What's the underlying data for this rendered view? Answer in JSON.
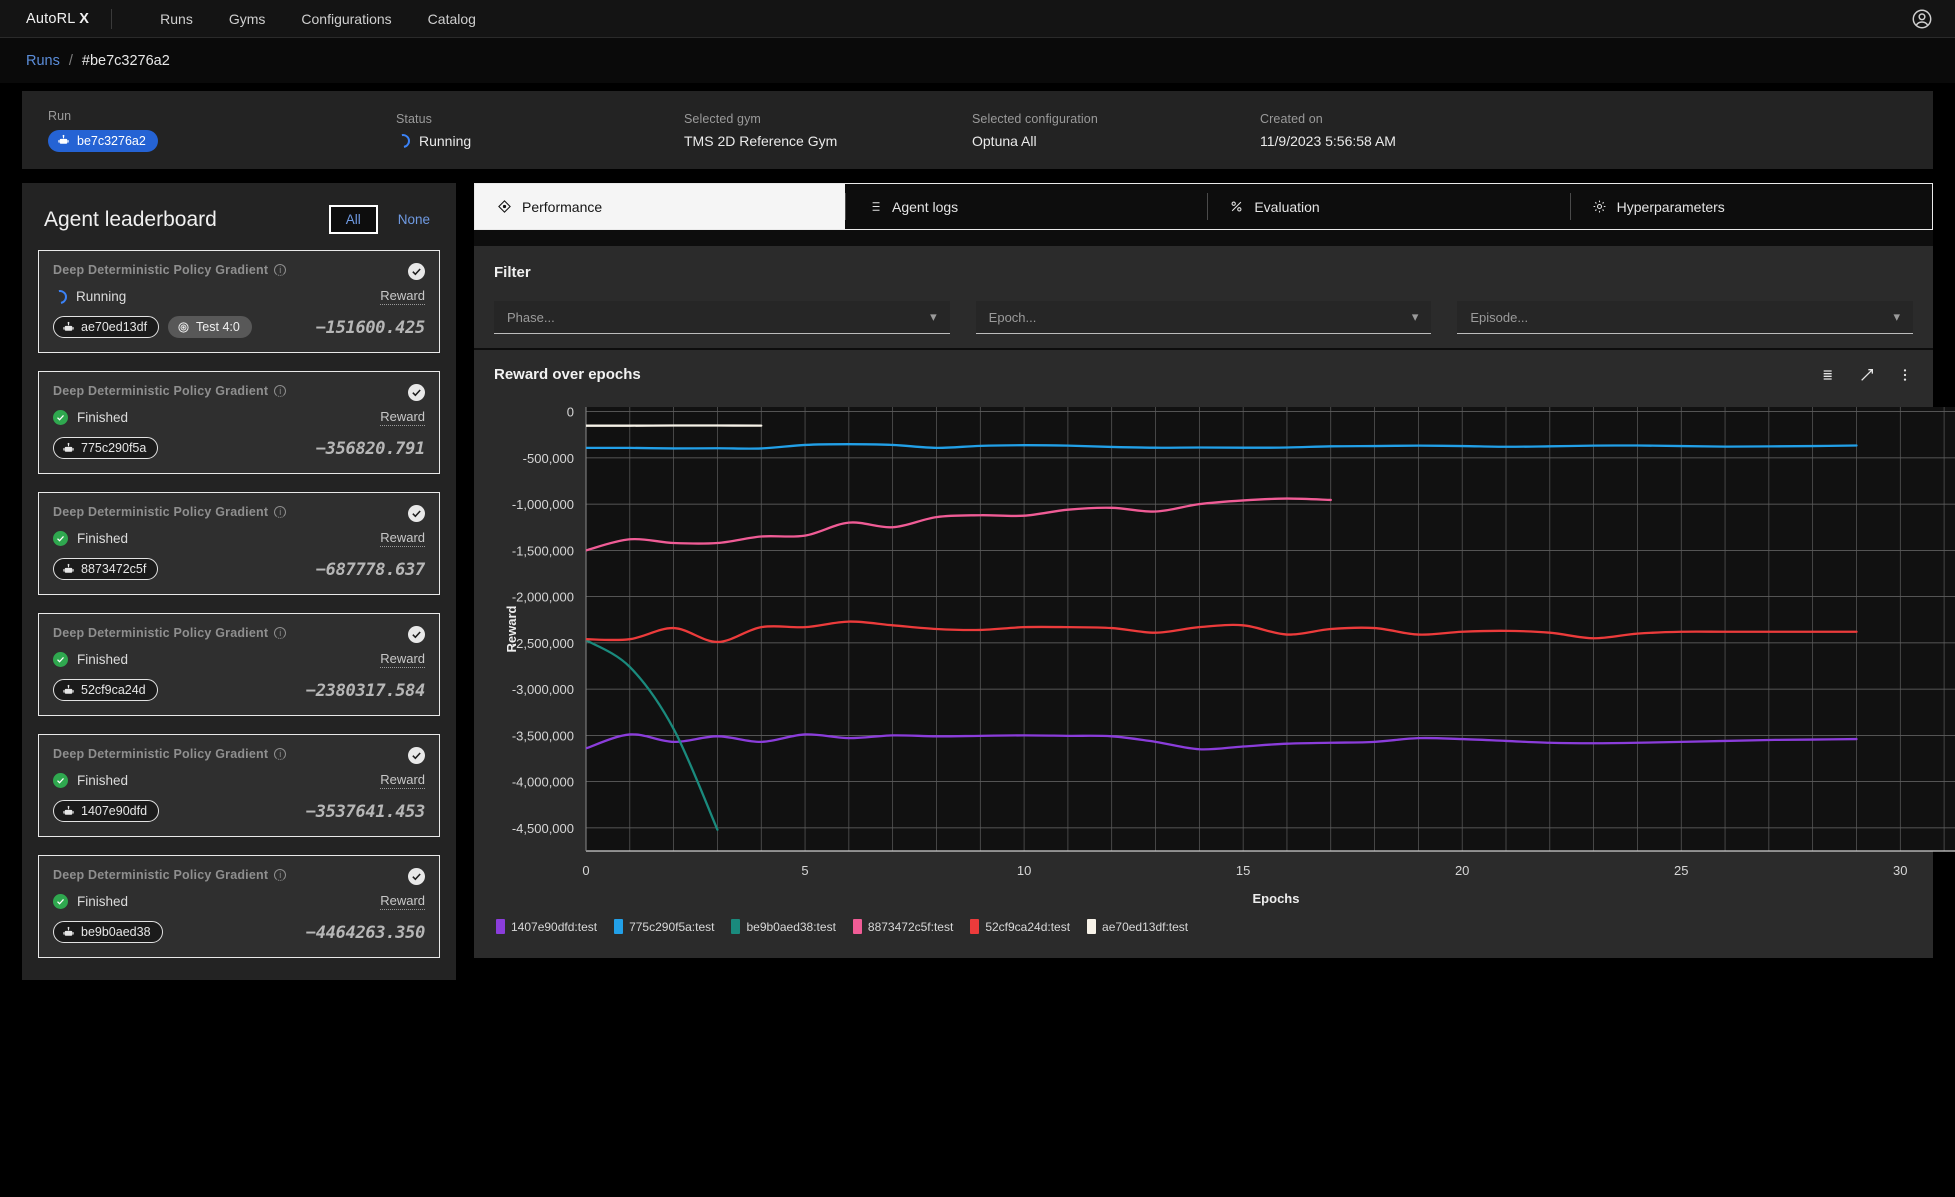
{
  "topnav": {
    "brand_prefix": "AutoRL ",
    "brand_suffix": "X",
    "links": [
      "Runs",
      "Gyms",
      "Configurations",
      "Catalog"
    ],
    "account_icon": "account-circle-icon"
  },
  "breadcrumb": {
    "root": "Runs",
    "separator": "/",
    "current": "#be7c3276a2"
  },
  "summary": {
    "run_label": "Run",
    "run_chip": "be7c3276a2",
    "status_label": "Status",
    "status_value": "Running",
    "gym_label": "Selected gym",
    "gym_value": "TMS 2D Reference Gym",
    "config_label": "Selected configuration",
    "config_value": "Optuna All",
    "created_label": "Created on",
    "created_value": "11/9/2023 5:56:58 AM"
  },
  "leaderboard": {
    "title": "Agent leaderboard",
    "all_label": "All",
    "none_label": "None",
    "reward_label": "Reward",
    "agents": [
      {
        "algo": "Deep Deterministic Policy Gradient",
        "state": "Running",
        "id": "ae70ed13df",
        "extra": "Test 4:0",
        "reward": "-151600.425"
      },
      {
        "algo": "Deep Deterministic Policy Gradient",
        "state": "Finished",
        "id": "775c290f5a",
        "extra": "",
        "reward": "-356820.791"
      },
      {
        "algo": "Deep Deterministic Policy Gradient",
        "state": "Finished",
        "id": "8873472c5f",
        "extra": "",
        "reward": "-687778.637"
      },
      {
        "algo": "Deep Deterministic Policy Gradient",
        "state": "Finished",
        "id": "52cf9ca24d",
        "extra": "",
        "reward": "-2380317.584"
      },
      {
        "algo": "Deep Deterministic Policy Gradient",
        "state": "Finished",
        "id": "1407e90dfd",
        "extra": "",
        "reward": "-3537641.453"
      },
      {
        "algo": "Deep Deterministic Policy Gradient",
        "state": "Finished",
        "id": "be9b0aed38",
        "extra": "",
        "reward": "-4464263.350"
      }
    ]
  },
  "tabs": [
    {
      "label": "Performance",
      "icon": "diamond-icon",
      "active": true
    },
    {
      "label": "Agent logs",
      "icon": "list-icon",
      "active": false
    },
    {
      "label": "Evaluation",
      "icon": "percent-icon",
      "active": false
    },
    {
      "label": "Hyperparameters",
      "icon": "gear-icon",
      "active": false
    }
  ],
  "filter": {
    "title": "Filter",
    "selects": [
      {
        "name": "phase",
        "placeholder": "Phase..."
      },
      {
        "name": "epoch",
        "placeholder": "Epoch..."
      },
      {
        "name": "episode",
        "placeholder": "Episode..."
      }
    ]
  },
  "chart_panel": {
    "title": "Reward over epochs",
    "tools": [
      "list-view-icon",
      "expand-icon",
      "more-vertical-icon"
    ]
  },
  "chart_data": {
    "type": "line",
    "title": "Reward over epochs",
    "xlabel": "Epochs",
    "ylabel": "Reward",
    "xlim": [
      0,
      31.5
    ],
    "ylim": [
      -4750000,
      50000
    ],
    "xticks": [
      0,
      5,
      10,
      15,
      20,
      25,
      30
    ],
    "yticks": [
      0,
      -500000,
      -1000000,
      -1500000,
      -2000000,
      -2500000,
      -3000000,
      -3500000,
      -4000000,
      -4500000
    ],
    "ytick_labels": [
      "0",
      "-500,000",
      "-1,000,000",
      "-1,500,000",
      "-2,000,000",
      "-2,500,000",
      "-3,000,000",
      "-3,500,000",
      "-4,000,000",
      "-4,500,000"
    ],
    "grid": true,
    "legend_position": "bottom-left",
    "series": [
      {
        "name": "1407e90dfd:test",
        "color": "#8b3ddb",
        "x": [
          0,
          1,
          2,
          3,
          4,
          5,
          6,
          7,
          8,
          9,
          10,
          11,
          12,
          13,
          14,
          15,
          16,
          17,
          18,
          19,
          20,
          21,
          22,
          23,
          24,
          25,
          26,
          27,
          28,
          29
        ],
        "y": [
          -3640000,
          -3490000,
          -3570000,
          -3510000,
          -3570000,
          -3490000,
          -3530000,
          -3500000,
          -3510000,
          -3505000,
          -3500000,
          -3505000,
          -3510000,
          -3570000,
          -3650000,
          -3620000,
          -3590000,
          -3580000,
          -3570000,
          -3530000,
          -3540000,
          -3560000,
          -3580000,
          -3585000,
          -3580000,
          -3570000,
          -3560000,
          -3550000,
          -3545000,
          -3540000
        ]
      },
      {
        "name": "775c290f5a:test",
        "color": "#22a0e8",
        "x": [
          0,
          1,
          2,
          3,
          4,
          5,
          6,
          7,
          8,
          9,
          10,
          11,
          12,
          13,
          14,
          15,
          16,
          17,
          18,
          19,
          20,
          21,
          22,
          23,
          24,
          25,
          26,
          27,
          28,
          29
        ],
        "y": [
          -392000,
          -392000,
          -398000,
          -396000,
          -398000,
          -360000,
          -352000,
          -360000,
          -392000,
          -370000,
          -363000,
          -368000,
          -382000,
          -390000,
          -388000,
          -390000,
          -388000,
          -375000,
          -372000,
          -368000,
          -372000,
          -380000,
          -375000,
          -368000,
          -366000,
          -372000,
          -378000,
          -376000,
          -372000,
          -366000
        ]
      },
      {
        "name": "be9b0aed38:test",
        "color": "#1a8a7d",
        "x": [
          0,
          1,
          2,
          3
        ],
        "y": [
          -2470000,
          -2760000,
          -3430000,
          -4520000
        ]
      },
      {
        "name": "8873472c5f:test",
        "color": "#f05c96",
        "x": [
          0,
          1,
          2,
          3,
          4,
          5,
          6,
          7,
          8,
          9,
          10,
          11,
          12,
          13,
          14,
          15,
          16,
          17
        ],
        "y": [
          -1500000,
          -1380000,
          -1420000,
          -1420000,
          -1350000,
          -1340000,
          -1200000,
          -1250000,
          -1140000,
          -1120000,
          -1125000,
          -1060000,
          -1040000,
          -1080000,
          -1000000,
          -960000,
          -940000,
          -955000
        ]
      },
      {
        "name": "52cf9ca24d:test",
        "color": "#ec3b3b",
        "x": [
          0,
          1,
          2,
          3,
          4,
          5,
          6,
          7,
          8,
          9,
          10,
          11,
          12,
          13,
          14,
          15,
          16,
          17,
          18,
          19,
          20,
          21,
          22,
          23,
          24,
          25,
          26,
          27,
          28,
          29
        ],
        "y": [
          -2460000,
          -2460000,
          -2340000,
          -2490000,
          -2330000,
          -2330000,
          -2270000,
          -2310000,
          -2350000,
          -2360000,
          -2330000,
          -2330000,
          -2340000,
          -2390000,
          -2330000,
          -2310000,
          -2410000,
          -2350000,
          -2340000,
          -2410000,
          -2380000,
          -2370000,
          -2390000,
          -2450000,
          -2400000,
          -2380000,
          -2380000,
          -2380000,
          -2380000,
          -2380000
        ]
      },
      {
        "name": "ae70ed13df:test",
        "color": "#f7f2e8",
        "x": [
          0,
          1,
          2,
          3,
          4
        ],
        "y": [
          -152000,
          -152000,
          -150000,
          -150000,
          -151600
        ]
      }
    ],
    "legend": [
      {
        "label": "1407e90dfd:test",
        "color": "#8b3ddb"
      },
      {
        "label": "775c290f5a:test",
        "color": "#22a0e8"
      },
      {
        "label": "be9b0aed38:test",
        "color": "#1a8a7d"
      },
      {
        "label": "8873472c5f:test",
        "color": "#f05c96"
      },
      {
        "label": "52cf9ca24d:test",
        "color": "#ec3b3b"
      },
      {
        "label": "ae70ed13df:test",
        "color": "#f7f2e8"
      }
    ]
  }
}
